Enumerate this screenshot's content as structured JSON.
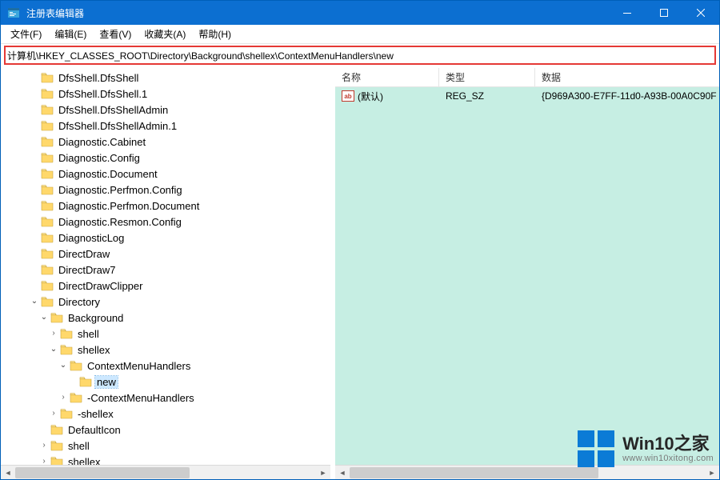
{
  "window": {
    "title": "注册表编辑器"
  },
  "menubar": [
    "文件(F)",
    "编辑(E)",
    "查看(V)",
    "收藏夹(A)",
    "帮助(H)"
  ],
  "address": "计算机\\HKEY_CLASSES_ROOT\\Directory\\Background\\shellex\\ContextMenuHandlers\\new",
  "tree": [
    {
      "d": 3,
      "t": null,
      "label": "DfsShell.DfsShell"
    },
    {
      "d": 3,
      "t": null,
      "label": "DfsShell.DfsShell.1"
    },
    {
      "d": 3,
      "t": null,
      "label": "DfsShell.DfsShellAdmin"
    },
    {
      "d": 3,
      "t": null,
      "label": "DfsShell.DfsShellAdmin.1"
    },
    {
      "d": 3,
      "t": null,
      "label": "Diagnostic.Cabinet"
    },
    {
      "d": 3,
      "t": null,
      "label": "Diagnostic.Config"
    },
    {
      "d": 3,
      "t": null,
      "label": "Diagnostic.Document"
    },
    {
      "d": 3,
      "t": null,
      "label": "Diagnostic.Perfmon.Config"
    },
    {
      "d": 3,
      "t": null,
      "label": "Diagnostic.Perfmon.Document"
    },
    {
      "d": 3,
      "t": null,
      "label": "Diagnostic.Resmon.Config"
    },
    {
      "d": 3,
      "t": null,
      "label": "DiagnosticLog"
    },
    {
      "d": 3,
      "t": null,
      "label": "DirectDraw"
    },
    {
      "d": 3,
      "t": null,
      "label": "DirectDraw7"
    },
    {
      "d": 3,
      "t": null,
      "label": "DirectDrawClipper"
    },
    {
      "d": 3,
      "t": "open",
      "label": "Directory"
    },
    {
      "d": 4,
      "t": "open",
      "label": "Background"
    },
    {
      "d": 5,
      "t": "closed",
      "label": "shell"
    },
    {
      "d": 5,
      "t": "open",
      "label": "shellex"
    },
    {
      "d": 6,
      "t": "open",
      "label": "ContextMenuHandlers"
    },
    {
      "d": 7,
      "t": null,
      "label": "new",
      "selected": true
    },
    {
      "d": 6,
      "t": "closed",
      "label": "-ContextMenuHandlers"
    },
    {
      "d": 5,
      "t": "closed",
      "label": "-shellex"
    },
    {
      "d": 4,
      "t": null,
      "label": "DefaultIcon"
    },
    {
      "d": 4,
      "t": "closed",
      "label": "shell"
    },
    {
      "d": 4,
      "t": "closed",
      "label": "shellex"
    }
  ],
  "columns": {
    "name": "名称",
    "type": "类型",
    "data": "数据"
  },
  "values": [
    {
      "icon": "ab",
      "name": "(默认)",
      "type": "REG_SZ",
      "data": "{D969A300-E7FF-11d0-A93B-00A0C90F"
    }
  ],
  "watermark": {
    "main": "Win10之家",
    "sub": "www.win10xitong.com"
  }
}
